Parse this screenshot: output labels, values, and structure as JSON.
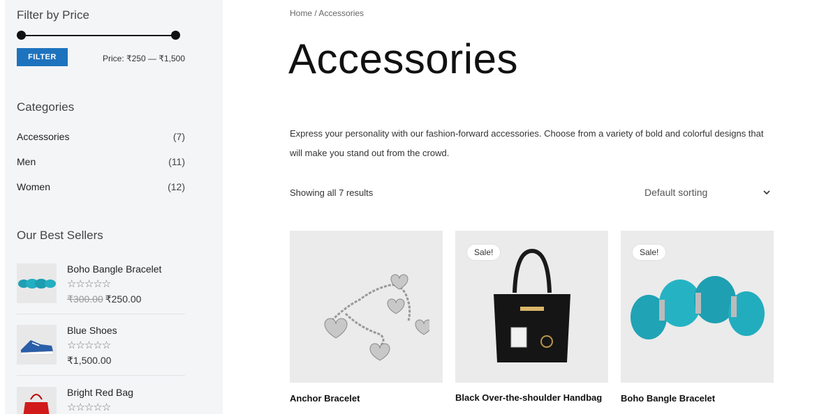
{
  "sidebar": {
    "price_filter": {
      "title": "Filter by Price",
      "button_label": "FILTER",
      "price_label": "Price: ₹250 — ₹1,500"
    },
    "categories": {
      "title": "Categories",
      "items": [
        {
          "label": "Accessories",
          "count": "(7)"
        },
        {
          "label": "Men",
          "count": "(11)"
        },
        {
          "label": "Women",
          "count": "(12)"
        }
      ]
    },
    "best_sellers": {
      "title": "Our Best Sellers",
      "items": [
        {
          "name": "Boho Bangle Bracelet",
          "stars": "☆☆☆☆☆",
          "old_price": "₹300.00",
          "price": "₹250.00"
        },
        {
          "name": "Blue Shoes",
          "stars": "☆☆☆☆☆",
          "old_price": "",
          "price": "₹1,500.00"
        },
        {
          "name": "Bright Red Bag",
          "stars": "☆☆☆☆☆",
          "old_price": "",
          "price": ""
        }
      ]
    }
  },
  "main": {
    "breadcrumb": "Home / Accessories",
    "title": "Accessories",
    "description": "Express your personality with our fashion-forward accessories. Choose from a variety of bold and colorful designs that will make you stand out from the crowd.",
    "result_count": "Showing all 7 results",
    "sort_selected": "Default sorting",
    "products": [
      {
        "name": "Anchor Bracelet",
        "badge": ""
      },
      {
        "name": "Black Over-the-shoulder Handbag",
        "badge": "Sale!"
      },
      {
        "name": "Boho Bangle Bracelet",
        "badge": "Sale!"
      }
    ]
  },
  "colors": {
    "accent": "#1e73be",
    "sidebar_bg": "#f4f5f7",
    "product_bg": "#ebebeb"
  },
  "icons": [
    "chevron-down-icon",
    "star-rating-icon",
    "slider-handle"
  ]
}
